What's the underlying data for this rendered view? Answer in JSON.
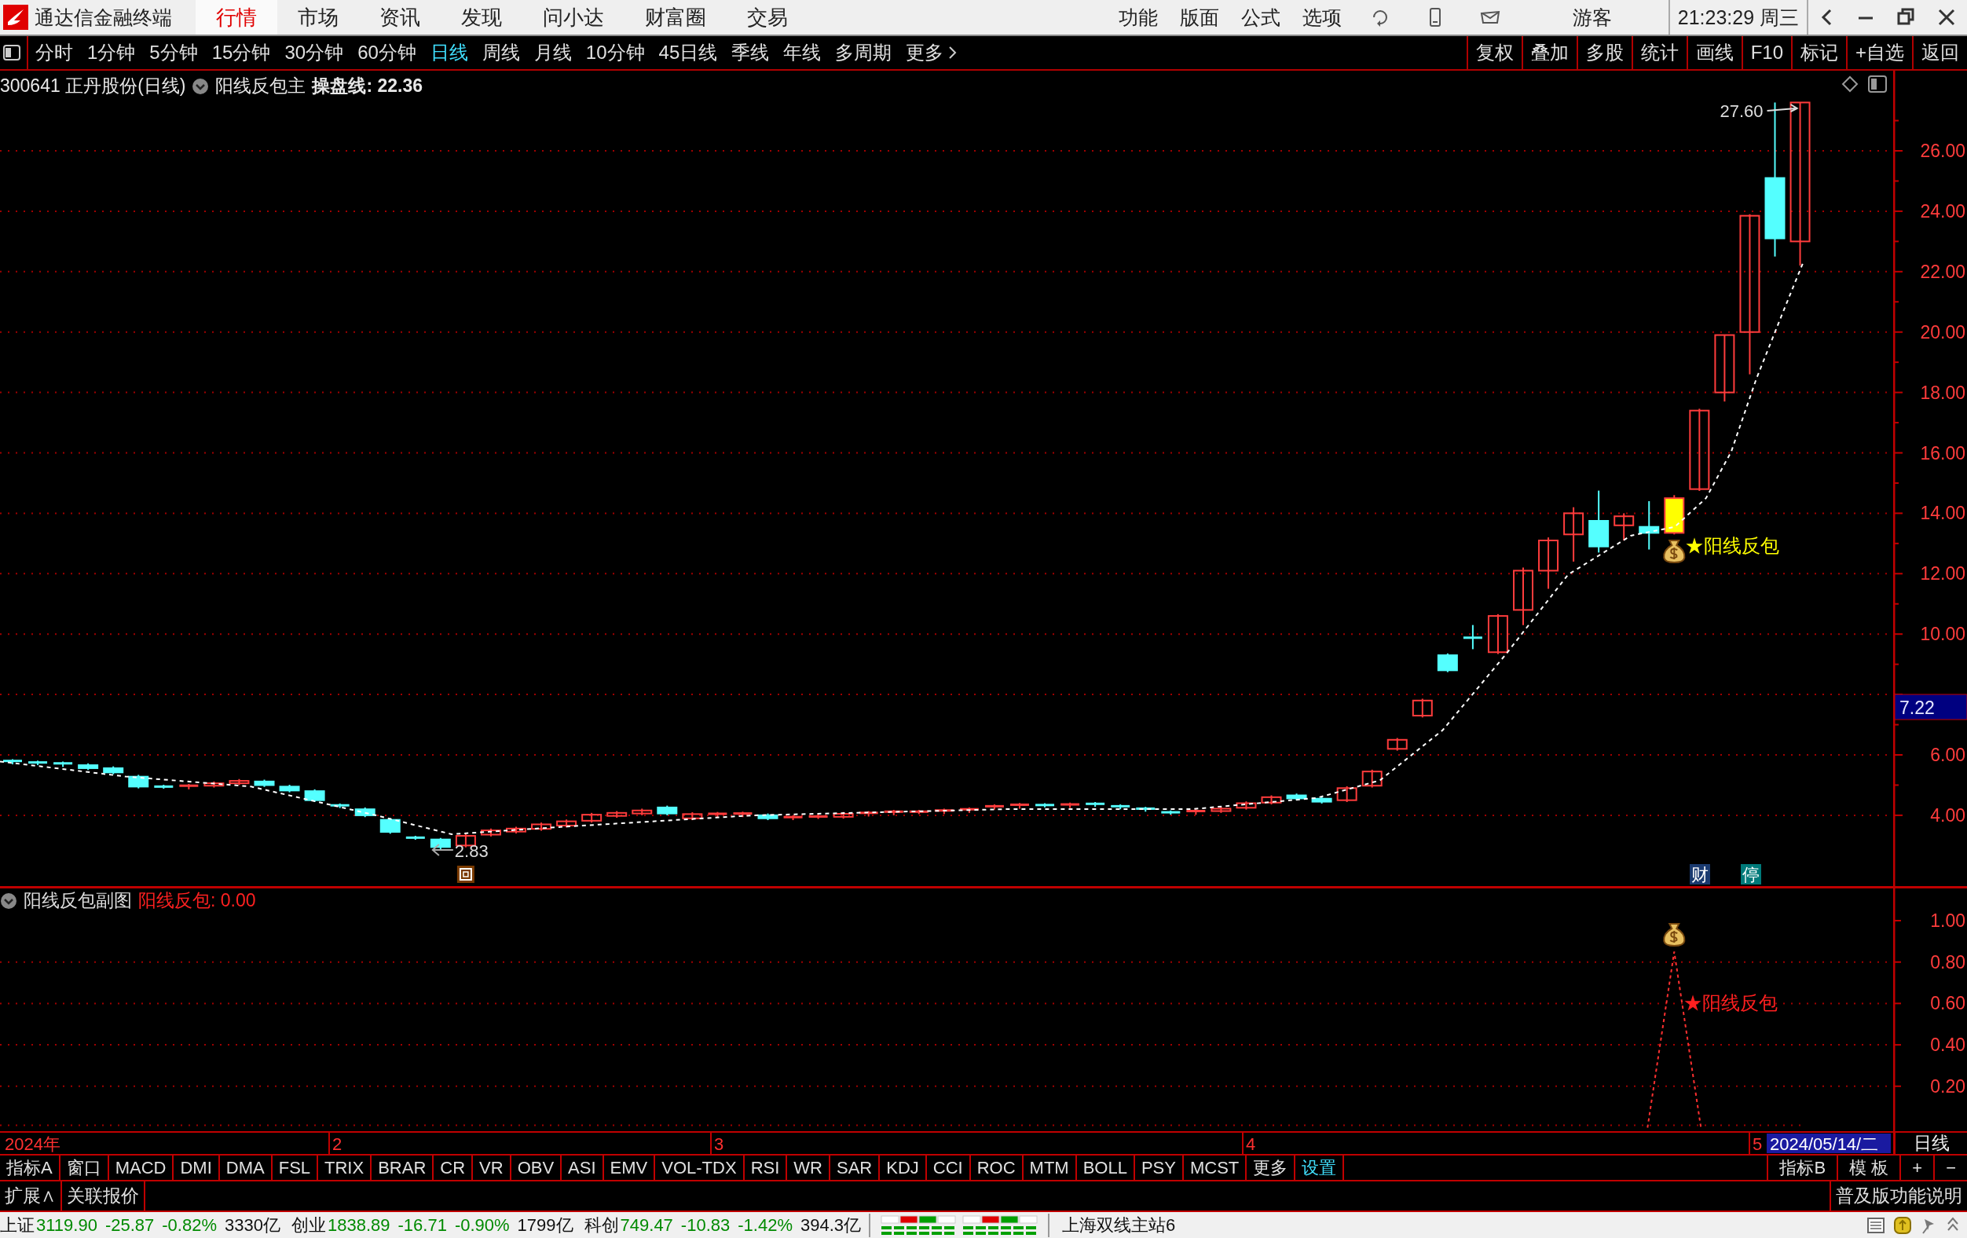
{
  "title_bar": {
    "app_name": "通达信金融终端",
    "tabs": [
      {
        "label": "行情",
        "selected": true
      },
      {
        "label": "市场",
        "selected": false
      },
      {
        "label": "资讯",
        "selected": false
      },
      {
        "label": "发现",
        "selected": false
      },
      {
        "label": "问小达",
        "selected": false
      },
      {
        "label": "财富圈",
        "selected": false
      },
      {
        "label": "交易",
        "selected": false
      }
    ],
    "menu": [
      "功能",
      "版面",
      "公式",
      "选项"
    ],
    "user": "游客",
    "clock": "21:23:29 周三"
  },
  "period_bar": {
    "periods": [
      {
        "label": "分时",
        "selected": false
      },
      {
        "label": "1分钟",
        "selected": false
      },
      {
        "label": "5分钟",
        "selected": false
      },
      {
        "label": "15分钟",
        "selected": false
      },
      {
        "label": "30分钟",
        "selected": false
      },
      {
        "label": "60分钟",
        "selected": false
      },
      {
        "label": "日线",
        "selected": true
      },
      {
        "label": "周线",
        "selected": false
      },
      {
        "label": "月线",
        "selected": false
      },
      {
        "label": "10分钟",
        "selected": false
      },
      {
        "label": "45日线",
        "selected": false
      },
      {
        "label": "季线",
        "selected": false
      },
      {
        "label": "年线",
        "selected": false
      },
      {
        "label": "多周期",
        "selected": false
      }
    ],
    "more": "更多",
    "tools": [
      "复权",
      "叠加",
      "多股",
      "统计",
      "画线",
      "F10",
      "标记",
      "+自选",
      "返回"
    ]
  },
  "main_chart": {
    "stock": "300641 正丹股份(日线)",
    "formula": "阳线反包主",
    "line_value": "操盘线: 22.36",
    "y_ticks": [
      "26.00",
      "24.00",
      "22.00",
      "20.00",
      "18.00",
      "16.00",
      "14.00",
      "12.00",
      "10.00",
      "6.00",
      "4.00"
    ],
    "price_tag": "7.22",
    "high_label": "27.60",
    "low_label": "2.83",
    "signal_label": "★阳线反包",
    "badges": [
      "财",
      "停"
    ]
  },
  "sub_chart": {
    "title": "阳线反包副图",
    "value": "阳线反包: 0.00",
    "y_ticks": [
      "1.00",
      "0.80",
      "0.60",
      "0.40",
      "0.20"
    ],
    "signal_label": "★阳线反包"
  },
  "date_axis": {
    "year": "2024年",
    "months": [
      "2",
      "3",
      "4",
      "5"
    ],
    "cursor_date": "2024/05/14/二",
    "period": "日线"
  },
  "indicator_bar": {
    "tabs": [
      "指标A",
      "窗口",
      "MACD",
      "DMI",
      "DMA",
      "FSL",
      "TRIX",
      "BRAR",
      "CR",
      "VR",
      "OBV",
      "ASI",
      "EMV",
      "VOL-TDX",
      "RSI",
      "WR",
      "SAR",
      "KDJ",
      "CCI",
      "ROC",
      "MTM",
      "BOLL",
      "PSY",
      "MCST",
      "更多"
    ],
    "settings": "设置",
    "right": [
      "指标B",
      "模 板",
      "+",
      "−"
    ]
  },
  "extension_bar": {
    "left": [
      "扩展∧",
      "关联报价"
    ],
    "right": "普及版功能说明"
  },
  "status_bar": {
    "indices": [
      {
        "name": "上证",
        "value": "3119.90",
        "change": "-25.87",
        "percent": "-0.82%",
        "turnover": "3330亿"
      },
      {
        "name": "创业",
        "value": "1838.89",
        "change": "-16.71",
        "percent": "-0.90%",
        "turnover": "1799亿"
      },
      {
        "name": "科创",
        "value": "749.47",
        "change": "-10.83",
        "percent": "-1.42%",
        "turnover": "394.3亿"
      }
    ],
    "server": "上海双线主站6"
  }
}
